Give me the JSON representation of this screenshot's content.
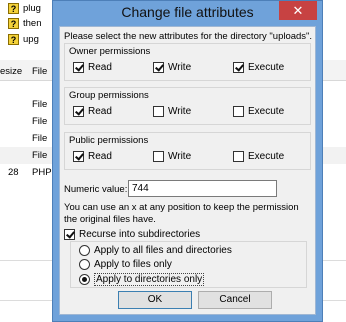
{
  "background_app": {
    "log_lines": [
      "plug",
      "then",
      "upg"
    ],
    "columns": {
      "size": "esize",
      "type": "File"
    },
    "rows": [
      {
        "size": "",
        "type": "File"
      },
      {
        "size": "",
        "type": "File"
      },
      {
        "size": "",
        "type": "File"
      },
      {
        "size": "",
        "type": "File"
      },
      {
        "size": "28",
        "type": "PHP"
      }
    ]
  },
  "dialog": {
    "title": "Change file attributes",
    "close_label": "✕",
    "description": "Please select the new attributes for the directory \"uploads\".",
    "groups": [
      {
        "title": "Owner permissions",
        "perms": [
          {
            "label": "Read",
            "checked": true
          },
          {
            "label": "Write",
            "checked": true
          },
          {
            "label": "Execute",
            "checked": true
          }
        ]
      },
      {
        "title": "Group permissions",
        "perms": [
          {
            "label": "Read",
            "checked": true
          },
          {
            "label": "Write",
            "checked": false
          },
          {
            "label": "Execute",
            "checked": false
          }
        ]
      },
      {
        "title": "Public permissions",
        "perms": [
          {
            "label": "Read",
            "checked": true
          },
          {
            "label": "Write",
            "checked": false
          },
          {
            "label": "Execute",
            "checked": false
          }
        ]
      }
    ],
    "numeric_label": "Numeric value:",
    "numeric_value": "744",
    "hint": "You can use an x at any position to keep the permission the original files have.",
    "recurse_label": "Recurse into subdirectories",
    "recurse_checked": true,
    "recurse_options": [
      {
        "label": "Apply to all files and directories",
        "selected": false
      },
      {
        "label": "Apply to files only",
        "selected": false
      },
      {
        "label": "Apply to directories only",
        "selected": true
      }
    ],
    "ok_label": "OK",
    "cancel_label": "Cancel"
  }
}
